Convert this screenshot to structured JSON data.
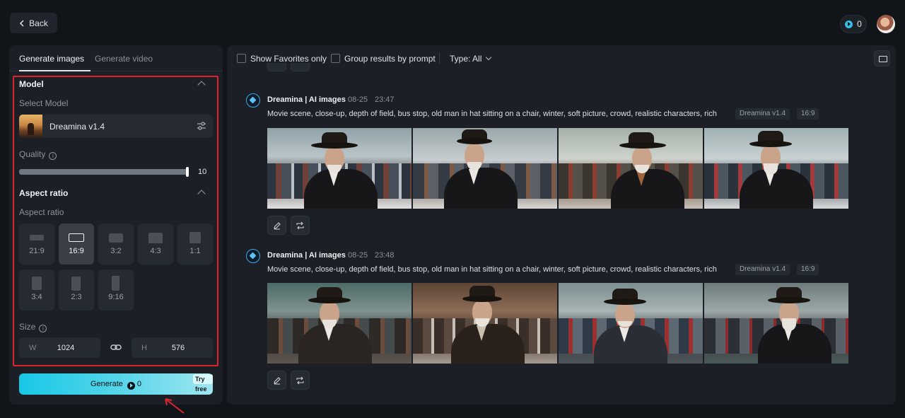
{
  "header": {
    "back_label": "Back",
    "credits": "0"
  },
  "tabs": [
    {
      "label": "Generate images",
      "active": true
    },
    {
      "label": "Generate video",
      "active": false
    }
  ],
  "model_section": {
    "title": "Model",
    "select_label": "Select Model",
    "selected_model": "Dreamina v1.4"
  },
  "quality": {
    "label": "Quality",
    "value": "10",
    "fraction": 1.0
  },
  "aspect_section": {
    "title": "Aspect ratio",
    "label": "Aspect ratio",
    "options": [
      "21:9",
      "16:9",
      "3:2",
      "4:3",
      "1:1",
      "3:4",
      "2:3",
      "9:16"
    ],
    "selected": "16:9"
  },
  "size": {
    "label": "Size",
    "width_prefix": "W",
    "width": "1024",
    "height_prefix": "H",
    "height": "576"
  },
  "generate": {
    "label": "Generate",
    "cost": "0",
    "badge": "Try free"
  },
  "filters": {
    "favorites_label": "Show Favorites only",
    "group_label": "Group results by prompt",
    "type_label": "Type: All"
  },
  "entries": [
    {
      "author": "Dreamina | AI images",
      "date": "08-25",
      "time": "23:47",
      "prompt": "Movie scene, close-up, depth of field, bus stop, old man in hat sitting on a chair, winter, soft picture, crowd, realistic characters, rich",
      "model_tag": "Dreamina v1.4",
      "ratio_tag": "16:9"
    },
    {
      "author": "Dreamina | AI images",
      "date": "08-25",
      "time": "23:48",
      "prompt": "Movie scene, close-up, depth of field, bus stop, old man in hat sitting on a chair, winter, soft picture, crowd, realistic characters, rich",
      "model_tag": "Dreamina v1.4",
      "ratio_tag": "16:9"
    }
  ],
  "colors": {
    "accent": "#18c8e6",
    "highlight_box": "#d9262c",
    "panel": "#1c1f25",
    "background": "#111419"
  }
}
